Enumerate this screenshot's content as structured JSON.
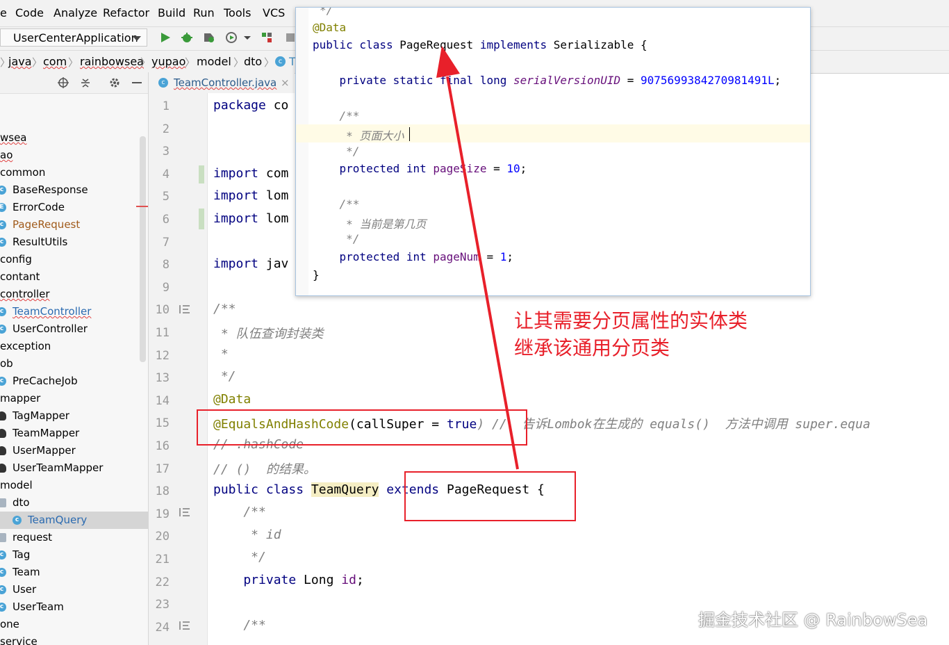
{
  "menu": [
    "e",
    "Code",
    "Analyze",
    "Refactor",
    "Build",
    "Run",
    "Tools",
    "VCS"
  ],
  "run_config": "UserCenterApplication",
  "breadcrumbs": [
    "java",
    "com",
    "rainbowsea",
    "yupao",
    "model",
    "dto",
    "T"
  ],
  "tab": {
    "label": "TeamController.java",
    "close": "×"
  },
  "project_tree": [
    {
      "label": "wsea",
      "icon": "none"
    },
    {
      "label": "ao",
      "icon": "none"
    },
    {
      "label": "common",
      "icon": "none"
    },
    {
      "label": "BaseResponse",
      "icon": "class"
    },
    {
      "label": "ErrorCode",
      "icon": "enum"
    },
    {
      "label": "PageRequest",
      "icon": "class"
    },
    {
      "label": "ResultUtils",
      "icon": "class"
    },
    {
      "label": "config",
      "icon": "none"
    },
    {
      "label": "contant",
      "icon": "none"
    },
    {
      "label": "controller",
      "icon": "none"
    },
    {
      "label": "TeamController",
      "icon": "class"
    },
    {
      "label": "UserController",
      "icon": "class"
    },
    {
      "label": "exception",
      "icon": "none"
    },
    {
      "label": "ob",
      "icon": "none"
    },
    {
      "label": "PreCacheJob",
      "icon": "class"
    },
    {
      "label": "mapper",
      "icon": "none"
    },
    {
      "label": "TagMapper",
      "icon": "mapper"
    },
    {
      "label": "TeamMapper",
      "icon": "mapper"
    },
    {
      "label": "UserMapper",
      "icon": "mapper"
    },
    {
      "label": "UserTeamMapper",
      "icon": "mapper"
    },
    {
      "label": "model",
      "icon": "none"
    },
    {
      "label": "dto",
      "icon": "folder"
    },
    {
      "label": "TeamQuery",
      "icon": "class"
    },
    {
      "label": "request",
      "icon": "folder"
    },
    {
      "label": "Tag",
      "icon": "class"
    },
    {
      "label": "Team",
      "icon": "class"
    },
    {
      "label": "User",
      "icon": "class"
    },
    {
      "label": "UserTeam",
      "icon": "class"
    },
    {
      "label": "one",
      "icon": "none"
    },
    {
      "label": "service",
      "icon": "none"
    }
  ],
  "line_numbers": [
    "1",
    "2",
    "3",
    "4",
    "5",
    "6",
    "7",
    "8",
    "9",
    "10",
    "11",
    "12",
    "13",
    "14",
    "15",
    "16",
    "17",
    "18",
    "19",
    "20",
    "21",
    "22",
    "23",
    "24"
  ],
  "code": {
    "l1a": "package",
    "l1b": " co",
    "l4a": "import",
    "l4b": " com",
    "l5a": "import",
    "l5b": " lom",
    "l6a": "import",
    "l6b": " lom",
    "l8a": "import",
    "l8b": " jav",
    "l10": "/**",
    "l11": " * 队伍查询封装类",
    "l12": " *",
    "l13": " */",
    "l14": "@Data",
    "l15a": "@EqualsAndHashCode",
    "l15b": "(callSuper = ",
    "l15c": "true",
    "l15d": ") //  告诉Lombok在生成的 equals()  方法中调用 super.equa",
    "l16": "// .hashCode",
    "l17": "// ()  的结果。",
    "l18a": "public class",
    "l18b": "TeamQuery",
    "l18c": "extends",
    "l18d": " PageRequest {",
    "l19": "    /**",
    "l20": "     * id",
    "l21": "     */",
    "l22a": "    private",
    "l22b": " Long ",
    "l22c": "id",
    "l22d": ";",
    "l24": "    /**"
  },
  "popup": {
    "top": "*/",
    "ann": "@Data",
    "decl_a": "public class",
    "decl_b": " PageRequest ",
    "decl_c": "implements",
    "decl_d": " Serializable {",
    "f1a": "    private static final long ",
    "f1b": "serialVersionUID",
    "f1c": " = ",
    "f1d": "9075699384270981491L",
    "f1e": ";",
    "c1": "    /**",
    "c2": "     * 页面大小",
    "c3": "     */",
    "p1a": "    protected int ",
    "p1b": "pageSize",
    "p1c": " = ",
    "p1d": "10",
    "p1e": ";",
    "c4": "    /**",
    "c5": "     * 当前是第几页",
    "c6": "     */",
    "p2a": "    protected int ",
    "p2b": "pageNum",
    "p2c": " = ",
    "p2d": "1",
    "p2e": ";",
    "close": "}"
  },
  "annotation_text": [
    "让其需要分页属性的实体类",
    "继承该通用分页类"
  ],
  "watermark": "掘金技术社区 @ RainbowSea",
  "colors": {
    "accent_red": "#e8202a",
    "keyword": "#000080",
    "annotation": "#808000",
    "comment": "#808080",
    "number": "#0000ff",
    "field": "#660e7a"
  }
}
